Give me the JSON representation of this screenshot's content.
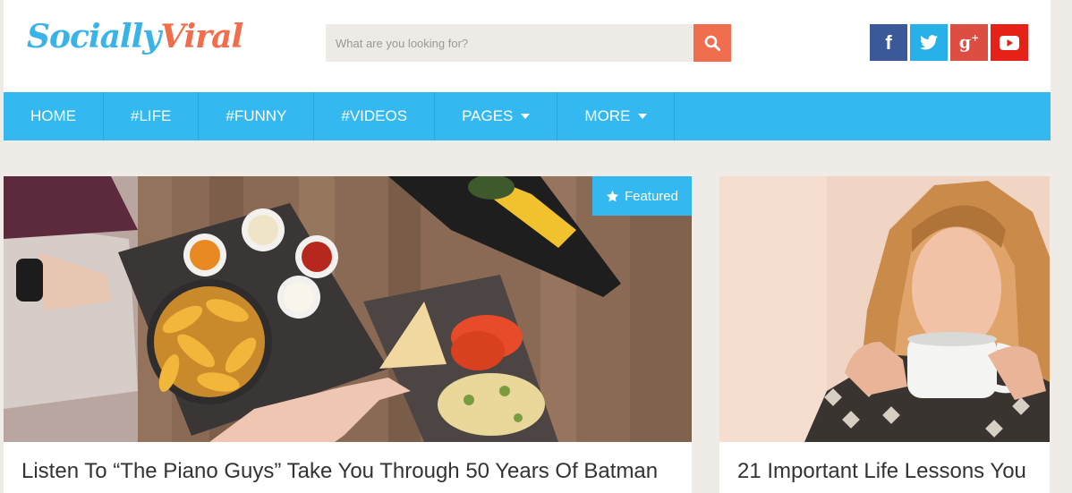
{
  "logo": {
    "part1": "Socially",
    "part2": "Viral"
  },
  "search": {
    "placeholder": "What are you looking for?"
  },
  "social": [
    "facebook-icon",
    "twitter-icon",
    "google-plus-icon",
    "youtube-icon"
  ],
  "nav": {
    "items": [
      {
        "label": "HOME"
      },
      {
        "label": "#LIFE"
      },
      {
        "label": "#FUNNY"
      },
      {
        "label": "#VIDEOS"
      },
      {
        "label": "PAGES"
      },
      {
        "label": "MORE"
      }
    ]
  },
  "posts": [
    {
      "title": "Listen To “The Piano Guys” Take You Through 50 Years Of Batman",
      "badge": "Featured"
    },
    {
      "title": "21 Important Life Lessons You"
    }
  ],
  "colors": {
    "accent_blue": "#33b9ef",
    "accent_orange": "#f06e4e",
    "logo_blue": "#3ab4e8",
    "logo_orange": "#f26d4c"
  }
}
